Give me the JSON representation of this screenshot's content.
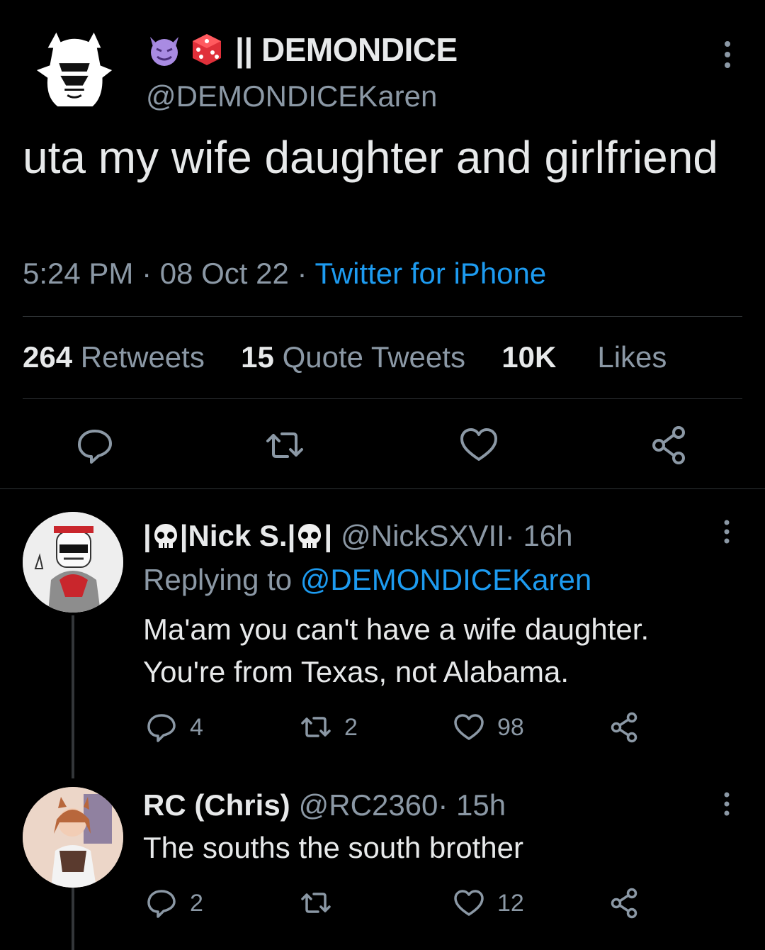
{
  "tweet": {
    "display_name": "|| DEMONDICE",
    "handle": "@DEMONDICEKaren",
    "text": "uta my wife daughter and girlfriend",
    "time": "5:24 PM",
    "sep1": " · ",
    "date": "08 Oct 22",
    "sep2": " · ",
    "source": "Twitter for iPhone",
    "retweets_count": "264",
    "retweets_label": "Retweets",
    "quotes_count": "15",
    "quotes_label": "Quote Tweets",
    "likes_count": "10K",
    "likes_label": "Likes",
    "name_icons": [
      "smiling-imp-emoji",
      "game-die-emoji"
    ]
  },
  "replies": [
    {
      "name_prefix": "|",
      "name_core": "|Nick S.|",
      "name_suffix": "|",
      "handle": "@NickSXVII",
      "time": " · 16h",
      "replying_label": "Replying to ",
      "replying_to": "@DEMONDICEKaren",
      "text": "Ma'am you can't have a wife daughter. You're from Texas, not Alabama.",
      "reply_count": "4",
      "retweet_count": "2",
      "like_count": "98"
    },
    {
      "name": "RC (Chris)",
      "handle": "@RC2360",
      "time": " · 15h",
      "text": "The souths the south brother",
      "reply_count": "2",
      "retweet_count": "",
      "like_count": "12"
    }
  ],
  "colors": {
    "background": "#000000",
    "text": "#e7e9ea",
    "muted": "#8b98a5",
    "link": "#1d9bf0",
    "divider": "#2f3336"
  }
}
